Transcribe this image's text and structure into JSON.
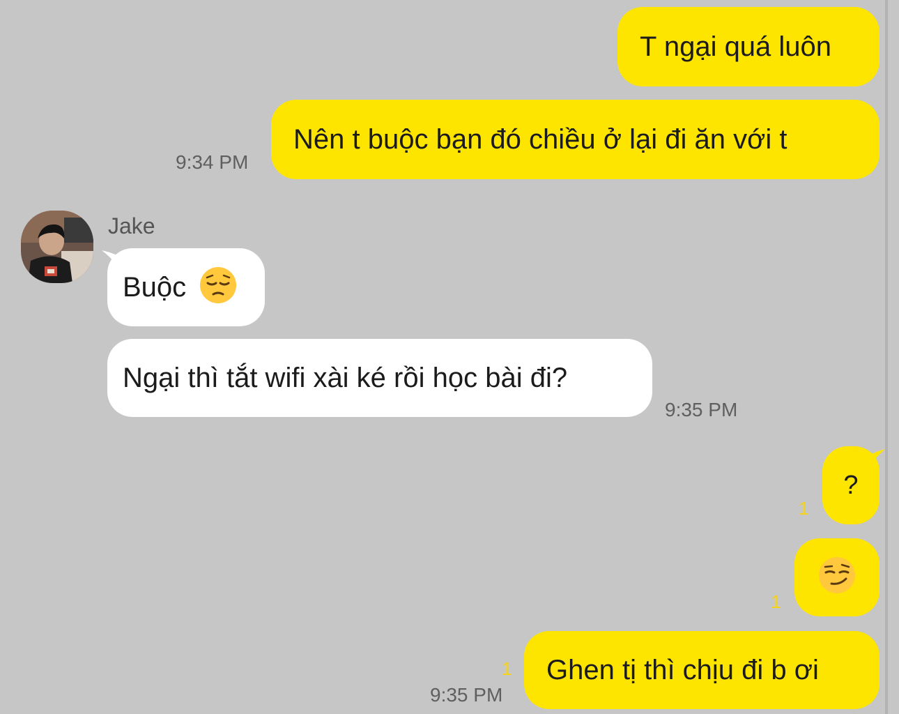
{
  "messages": [
    {
      "id": "m1",
      "text": "T ngại quá luôn"
    },
    {
      "id": "m2",
      "text": "Nên t buộc bạn đó chiều ở lại đi ăn với t",
      "time": "9:34 PM"
    },
    {
      "sender": "Jake"
    },
    {
      "id": "m3",
      "text": "Buộc"
    },
    {
      "id": "m4",
      "text": "Ngại thì tắt wifi xài ké rồi học bài đi?",
      "time": "9:35 PM"
    },
    {
      "id": "m5",
      "text": "?",
      "unread": "1"
    },
    {
      "id": "m6",
      "unread": "1"
    },
    {
      "id": "m7",
      "text": "Ghen tị thì chịu đi b ơi",
      "unread": "1",
      "time": "9:35 PM"
    }
  ],
  "colors": {
    "background": "#c6c6c6",
    "my_bubble": "#fee500",
    "their_bubble": "#ffffff",
    "unread_count": "#f5d31b"
  },
  "icons": {
    "m3_emoji": "pensive-face-emoji",
    "m6_emoji": "smirking-face-emoji",
    "avatar": "jake-profile-photo"
  }
}
